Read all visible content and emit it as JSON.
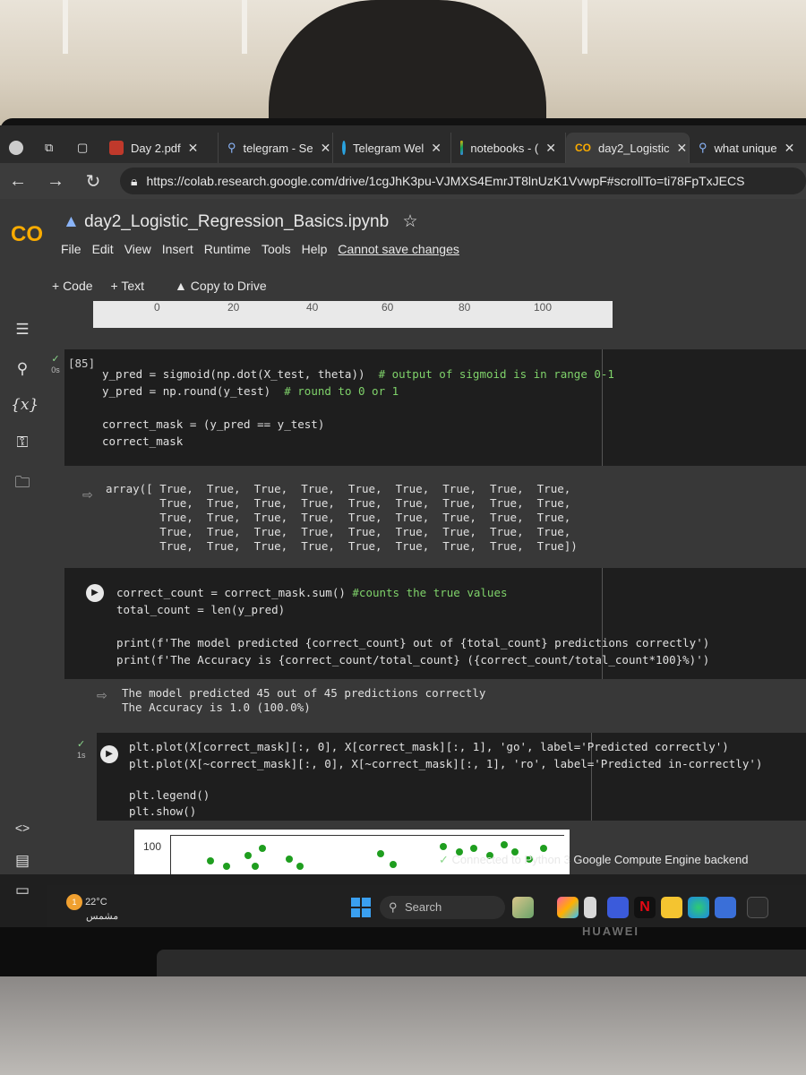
{
  "browser": {
    "tabs": [
      {
        "label": "Day 2.pdf",
        "icon": "pdf-icon"
      },
      {
        "label": "telegram - Se",
        "icon": "search-icon"
      },
      {
        "label": "Telegram Wel",
        "icon": "telegram-icon"
      },
      {
        "label": "notebooks - (",
        "icon": "drive-icon"
      },
      {
        "label": "day2_Logistic",
        "icon": "colab-icon",
        "active": true
      },
      {
        "label": "what unique",
        "icon": "search-icon"
      }
    ],
    "url": "https://colab.research.google.com/drive/1cgJhK3pu-VJMXS4EmrJT8lnUzK1VvwpF#scrollTo=ti78FpTxJECS"
  },
  "colab": {
    "logo": "CO",
    "title": "day2_Logistic_Regression_Basics.ipynb",
    "menu": [
      "File",
      "Edit",
      "View",
      "Insert",
      "Runtime",
      "Tools",
      "Help"
    ],
    "save_warning": "Cannot save changes",
    "toolbar": {
      "code_label": "+ Code",
      "text_label": "+ Text",
      "drive_label": "Copy to Drive"
    }
  },
  "axis_ticks": [
    "0",
    "20",
    "40",
    "60",
    "80",
    "100"
  ],
  "cell1": {
    "exec_count": "[85]",
    "exec_time": "0s",
    "lines": [
      "y_pred = sigmoid(np.dot(X_test, theta))",
      "y_pred = np.round(y_test)",
      "",
      "correct_mask = (y_pred == y_test)",
      "correct_mask"
    ],
    "comments": [
      "# output of sigmoid is in range 0-1",
      "# round to 0 or 1"
    ],
    "output": [
      "array([ True,  True,  True,  True,  True,  True,  True,  True,  True,",
      "        True,  True,  True,  True,  True,  True,  True,  True,  True,",
      "        True,  True,  True,  True,  True,  True,  True,  True,  True,",
      "        True,  True,  True,  True,  True,  True,  True,  True,  True,",
      "        True,  True,  True,  True,  True,  True,  True,  True,  True])"
    ]
  },
  "cell2": {
    "lines": [
      "correct_count = correct_mask.sum()",
      "total_count = len(y_pred)",
      "",
      "print(f'The model predicted {correct_count} out of {total_count} predictions correctly')",
      "print(f'The Accuracy is {correct_count/total_count} ({correct_count/total_count*100}%)')"
    ],
    "comment": "#counts the true values",
    "output": [
      "The model predicted 45 out of 45 predictions correctly",
      "The Accuracy is 1.0 (100.0%)"
    ]
  },
  "cell3": {
    "exec_time": "1s",
    "lines": [
      "plt.plot(X[correct_mask][:, 0], X[correct_mask][:, 1], 'go', label='Predicted correctly')",
      "plt.plot(X[~correct_mask][:, 0], X[~correct_mask][:, 1], 'ro', label='Predicted in-correctly')",
      "",
      "plt.legend()",
      "plt.show()"
    ],
    "plot_ytick": "100"
  },
  "status": {
    "text": "Connected to Python 3 Google Compute Engine backend"
  },
  "taskbar": {
    "weather_temp": "22°C",
    "weather_desc": "مشمس",
    "search_label": "Search",
    "notification_count": "1"
  },
  "bezel_brand": "HUAWEI",
  "colors": {
    "accent": "#f9ab00",
    "cell_bg": "#1e1e1e",
    "comment": "#7fd26a",
    "string": "#f3a366",
    "green_dot": "#1f9e1f"
  }
}
